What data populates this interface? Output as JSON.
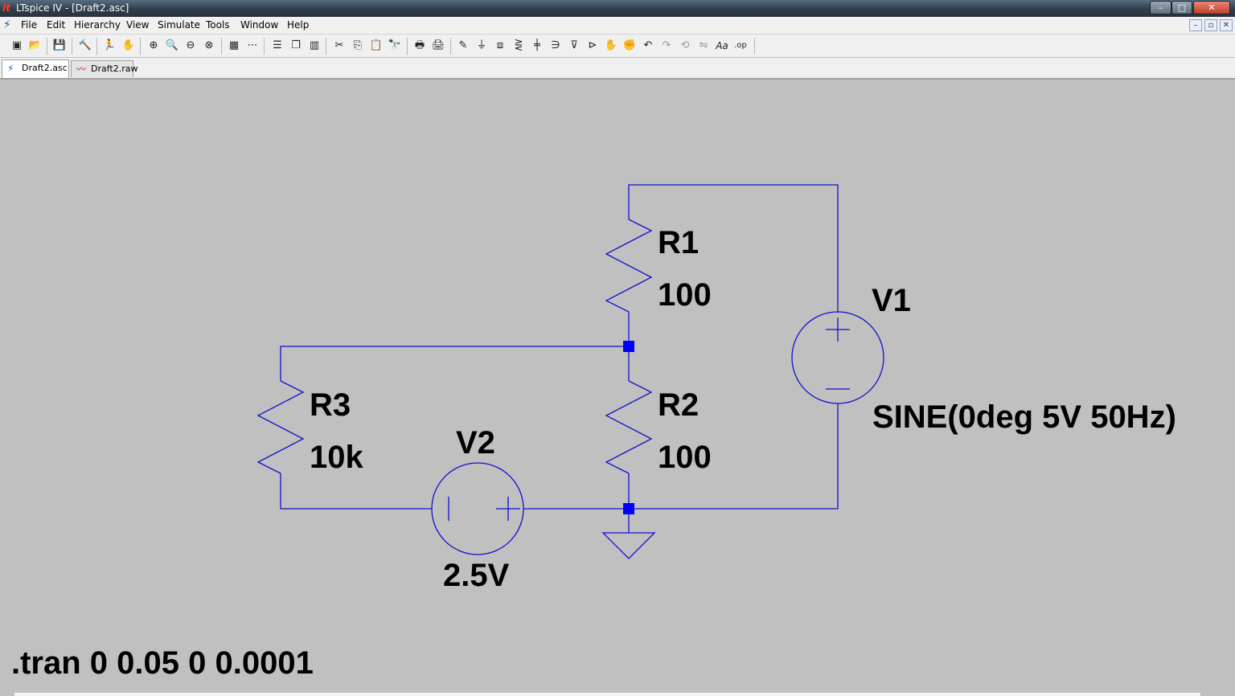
{
  "window": {
    "title": "LTspice IV - [Draft2.asc]",
    "controls": {
      "minimize": "–",
      "maximize": "□",
      "close": "✕"
    }
  },
  "menu": {
    "items": [
      "File",
      "Edit",
      "Hierarchy",
      "View",
      "Simulate",
      "Tools",
      "Window",
      "Help"
    ],
    "mdi_controls": {
      "minimize": "–",
      "restore": "▫",
      "close": "✕"
    }
  },
  "toolbar": {
    "buttons": [
      {
        "name": "new-schematic-icon",
        "glyph": "▣"
      },
      {
        "name": "open-icon",
        "glyph": "📂"
      },
      {
        "name": "save-icon",
        "glyph": "💾"
      },
      {
        "name": "control-panel-icon",
        "glyph": "🔨"
      },
      {
        "name": "run-icon",
        "glyph": "🏃"
      },
      {
        "name": "halt-icon",
        "glyph": "✋"
      },
      {
        "name": "zoom-area-icon",
        "glyph": "⊕"
      },
      {
        "name": "pan-icon",
        "glyph": "🔍"
      },
      {
        "name": "zoom-out-icon",
        "glyph": "⊖"
      },
      {
        "name": "zoom-fit-icon",
        "glyph": "⊗"
      },
      {
        "name": "autorange-icon",
        "glyph": "▦"
      },
      {
        "name": "grid-icon",
        "glyph": "⋯"
      },
      {
        "name": "tile-horizontal-icon",
        "glyph": "☰"
      },
      {
        "name": "cascade-icon",
        "glyph": "❐"
      },
      {
        "name": "tile-vertical-icon",
        "glyph": "▥"
      },
      {
        "name": "cut-icon",
        "glyph": "✂"
      },
      {
        "name": "copy-icon",
        "glyph": "⎘"
      },
      {
        "name": "paste-icon",
        "glyph": "📋"
      },
      {
        "name": "find-icon",
        "glyph": "🔭"
      },
      {
        "name": "print-setup-icon",
        "glyph": "🖶"
      },
      {
        "name": "print-icon",
        "glyph": "🖨"
      },
      {
        "name": "wire-icon",
        "glyph": "✎"
      },
      {
        "name": "ground-icon",
        "glyph": "⏚"
      },
      {
        "name": "label-net-icon",
        "glyph": "⧈"
      },
      {
        "name": "resistor-icon",
        "glyph": "⋛"
      },
      {
        "name": "capacitor-icon",
        "glyph": "╪"
      },
      {
        "name": "inductor-icon",
        "glyph": "∋"
      },
      {
        "name": "diode-icon",
        "glyph": "⊽"
      },
      {
        "name": "component-icon",
        "glyph": "⊳"
      },
      {
        "name": "move-icon",
        "glyph": "✋"
      },
      {
        "name": "drag-icon",
        "glyph": "✊"
      },
      {
        "name": "undo-icon",
        "glyph": "↶"
      },
      {
        "name": "redo-icon",
        "glyph": "↷"
      },
      {
        "name": "rotate-icon",
        "glyph": "⟲"
      },
      {
        "name": "mirror-icon",
        "glyph": "⇋"
      },
      {
        "name": "text-icon",
        "glyph": "Aa"
      },
      {
        "name": "spice-directive-icon",
        "glyph": ".op"
      }
    ]
  },
  "tabs": [
    {
      "label": "Draft2.asc",
      "icon": "schematic-icon",
      "active": true
    },
    {
      "label": "Draft2.raw",
      "icon": "waveform-icon",
      "active": false
    }
  ],
  "schematic": {
    "wire_color": "#1111cc",
    "junction_color": "#0000ff",
    "components": {
      "R1": {
        "name": "R1",
        "value": "100"
      },
      "R2": {
        "name": "R2",
        "value": "100"
      },
      "R3": {
        "name": "R3",
        "value": "10k"
      },
      "V1": {
        "name": "V1",
        "value": "SINE(0deg 5V 50Hz)"
      },
      "V2": {
        "name": "V2",
        "value": "2.5V"
      }
    },
    "directive": ".tran 0 0.05 0 0.0001"
  }
}
